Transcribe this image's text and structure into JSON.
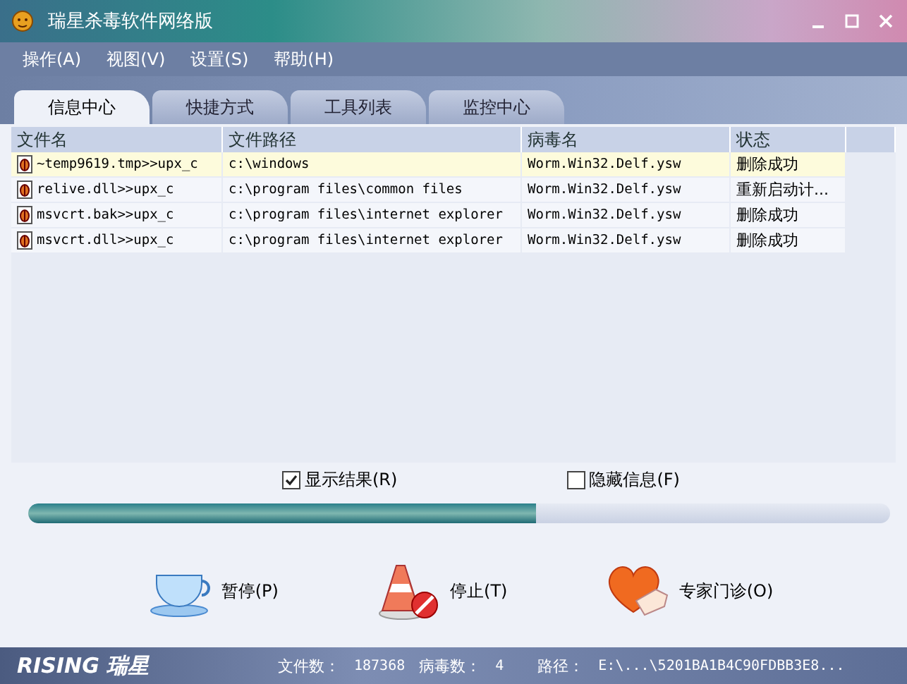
{
  "window": {
    "title": "瑞星杀毒软件网络版"
  },
  "menu": [
    "操作(A)",
    "视图(V)",
    "设置(S)",
    "帮助(H)"
  ],
  "tabs": [
    {
      "label": "信息中心",
      "selected": true
    },
    {
      "label": "快捷方式",
      "selected": false
    },
    {
      "label": "工具列表",
      "selected": false
    },
    {
      "label": "监控中心",
      "selected": false
    }
  ],
  "table": {
    "columns": [
      "文件名",
      "文件路径",
      "病毒名",
      "状态"
    ],
    "rows": [
      {
        "cells": [
          "~temp9619.tmp>>upx_c",
          "c:\\windows",
          "Worm.Win32.Delf.ysw",
          "删除成功"
        ],
        "selected": true
      },
      {
        "cells": [
          "relive.dll>>upx_c",
          "c:\\program files\\common files",
          "Worm.Win32.Delf.ysw",
          "重新启动计..."
        ],
        "selected": false
      },
      {
        "cells": [
          "msvcrt.bak>>upx_c",
          "c:\\program files\\internet explorer",
          "Worm.Win32.Delf.ysw",
          "删除成功"
        ],
        "selected": false
      },
      {
        "cells": [
          "msvcrt.dll>>upx_c",
          "c:\\program files\\internet explorer",
          "Worm.Win32.Delf.ysw",
          "删除成功"
        ],
        "selected": false
      }
    ]
  },
  "options": [
    {
      "label": "显示结果(R)",
      "checked": true
    },
    {
      "label": "隐藏信息(F)",
      "checked": false
    }
  ],
  "progress": {
    "level": 0.59
  },
  "actions": [
    {
      "kind": "pause",
      "label": "暂停(P)"
    },
    {
      "kind": "stop",
      "label": "停止(T)"
    },
    {
      "kind": "expert",
      "label": "专家门诊(O)"
    }
  ],
  "status_bar": {
    "logo": "RISING 瑞星",
    "files_label": "文件数：",
    "files": "187368",
    "virus_label": "病毒数：",
    "viruses": "4",
    "path_label": "路径：",
    "path": "E:\\...\\5201BA1B4C90FDBB3E8..."
  }
}
